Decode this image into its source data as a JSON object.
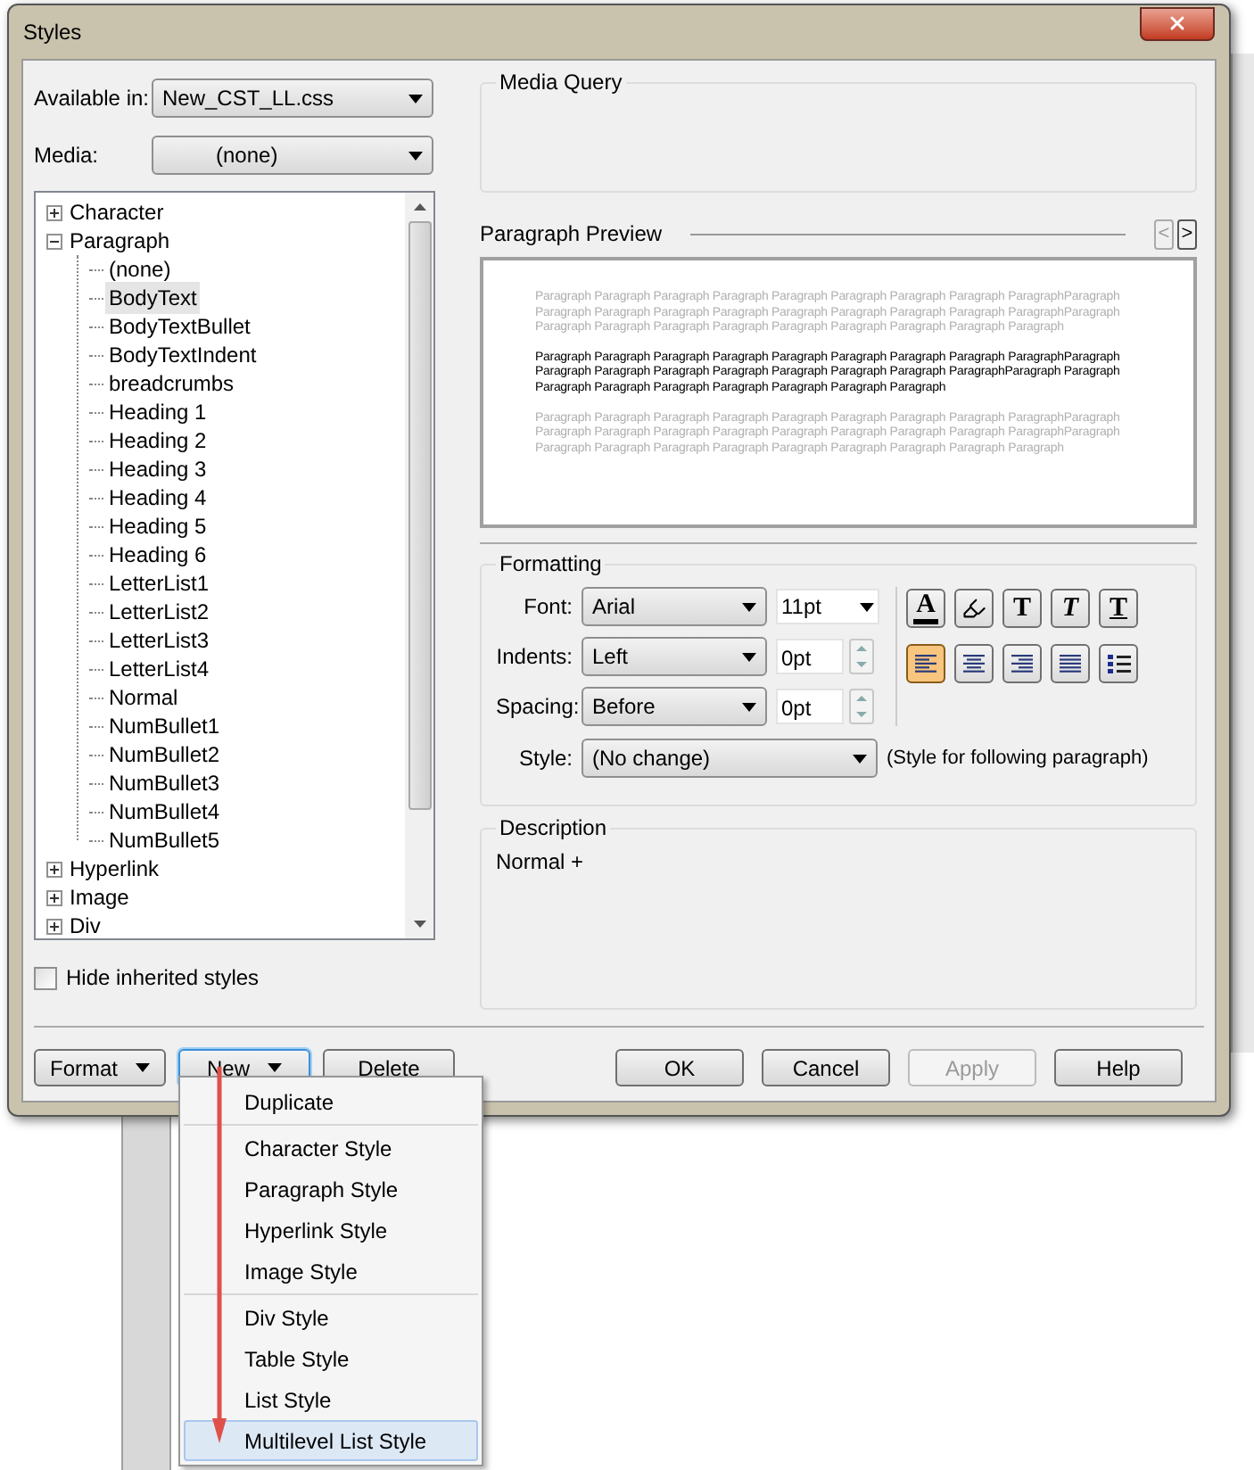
{
  "window": {
    "title": "Styles"
  },
  "available_in": {
    "label": "Available in:",
    "value": "New_CST_LL.css"
  },
  "media": {
    "label": "Media:",
    "value": "(none)"
  },
  "tree": [
    {
      "label": "Character",
      "expanded": false,
      "selected": false
    },
    {
      "label": "Paragraph",
      "expanded": true,
      "selected": false,
      "children": [
        {
          "label": "(none)",
          "selected": false
        },
        {
          "label": "BodyText",
          "selected": true
        },
        {
          "label": "BodyTextBullet",
          "selected": false
        },
        {
          "label": "BodyTextIndent",
          "selected": false
        },
        {
          "label": "breadcrumbs",
          "selected": false
        },
        {
          "label": "Heading 1",
          "selected": false
        },
        {
          "label": "Heading 2",
          "selected": false
        },
        {
          "label": "Heading 3",
          "selected": false
        },
        {
          "label": "Heading 4",
          "selected": false
        },
        {
          "label": "Heading 5",
          "selected": false
        },
        {
          "label": "Heading 6",
          "selected": false
        },
        {
          "label": "LetterList1",
          "selected": false
        },
        {
          "label": "LetterList2",
          "selected": false
        },
        {
          "label": "LetterList3",
          "selected": false
        },
        {
          "label": "LetterList4",
          "selected": false
        },
        {
          "label": "Normal",
          "selected": false
        },
        {
          "label": "NumBullet1",
          "selected": false
        },
        {
          "label": "NumBullet2",
          "selected": false
        },
        {
          "label": "NumBullet3",
          "selected": false
        },
        {
          "label": "NumBullet4",
          "selected": false
        },
        {
          "label": "NumBullet5",
          "selected": false
        }
      ]
    },
    {
      "label": "Hyperlink",
      "expanded": false,
      "selected": false
    },
    {
      "label": "Image",
      "expanded": false,
      "selected": false
    },
    {
      "label": "Div",
      "expanded": false,
      "selected": false
    }
  ],
  "hide_inherited": {
    "label": "Hide inherited styles",
    "checked": false
  },
  "media_query": {
    "title": "Media Query"
  },
  "preview": {
    "title": "Paragraph Preview",
    "prev": "<",
    "next": ">",
    "paragraphs": [
      {
        "kind": "context",
        "text": "Paragraph Paragraph Paragraph Paragraph Paragraph Paragraph Paragraph Paragraph ParagraphParagraph Paragraph Paragraph Paragraph Paragraph Paragraph Paragraph Paragraph Paragraph ParagraphParagraph Paragraph Paragraph Paragraph Paragraph Paragraph Paragraph Paragraph Paragraph Paragraph"
      },
      {
        "kind": "current",
        "text": "Paragraph Paragraph Paragraph Paragraph Paragraph Paragraph Paragraph Paragraph ParagraphParagraph Paragraph Paragraph Paragraph Paragraph Paragraph Paragraph Paragraph ParagraphParagraph Paragraph Paragraph Paragraph Paragraph Paragraph Paragraph Paragraph Paragraph"
      },
      {
        "kind": "context",
        "text": "Paragraph Paragraph Paragraph Paragraph Paragraph Paragraph Paragraph Paragraph ParagraphParagraph Paragraph Paragraph Paragraph Paragraph Paragraph Paragraph Paragraph Paragraph ParagraphParagraph Paragraph Paragraph Paragraph Paragraph Paragraph Paragraph Paragraph Paragraph Paragraph"
      }
    ]
  },
  "formatting": {
    "title": "Formatting",
    "font": {
      "label": "Font:",
      "value": "Arial",
      "size": "11pt"
    },
    "indents": {
      "label": "Indents:",
      "value": "Left",
      "amount": "0pt"
    },
    "spacing": {
      "label": "Spacing:",
      "value": "Before",
      "amount": "0pt"
    },
    "style": {
      "label": "Style:",
      "value": "(No change)",
      "note": "(Style for following paragraph)"
    },
    "text_buttons": [
      {
        "kind": "color",
        "glyph": "A"
      },
      {
        "kind": "highlight"
      },
      {
        "kind": "bold",
        "glyph": "T"
      },
      {
        "kind": "italic",
        "glyph": "T"
      },
      {
        "kind": "underline",
        "glyph": "T"
      }
    ],
    "align_buttons": [
      {
        "kind": "left",
        "selected": true
      },
      {
        "kind": "center",
        "selected": false
      },
      {
        "kind": "right",
        "selected": false
      },
      {
        "kind": "justify",
        "selected": false
      },
      {
        "kind": "list",
        "selected": false
      }
    ]
  },
  "description": {
    "title": "Description",
    "text": "Normal +"
  },
  "left_buttons": [
    {
      "label": "Format",
      "dropdown": true,
      "focused": false
    },
    {
      "label": "New",
      "dropdown": true,
      "focused": true
    },
    {
      "label": "Delete",
      "dropdown": false,
      "focused": false
    }
  ],
  "right_buttons": [
    {
      "label": "OK",
      "disabled": false
    },
    {
      "label": "Cancel",
      "disabled": false
    },
    {
      "label": "Apply",
      "disabled": true
    },
    {
      "label": "Help",
      "disabled": false
    }
  ],
  "new_menu": {
    "groups": [
      [
        {
          "label": "Duplicate",
          "selected": false
        }
      ],
      [
        {
          "label": "Character Style",
          "selected": false
        },
        {
          "label": "Paragraph Style",
          "selected": false
        },
        {
          "label": "Hyperlink Style",
          "selected": false
        },
        {
          "label": "Image Style",
          "selected": false
        }
      ],
      [
        {
          "label": "Div Style",
          "selected": false
        },
        {
          "label": "Table Style",
          "selected": false
        },
        {
          "label": "List Style",
          "selected": false
        },
        {
          "label": "Multilevel List Style",
          "selected": true
        }
      ]
    ]
  }
}
